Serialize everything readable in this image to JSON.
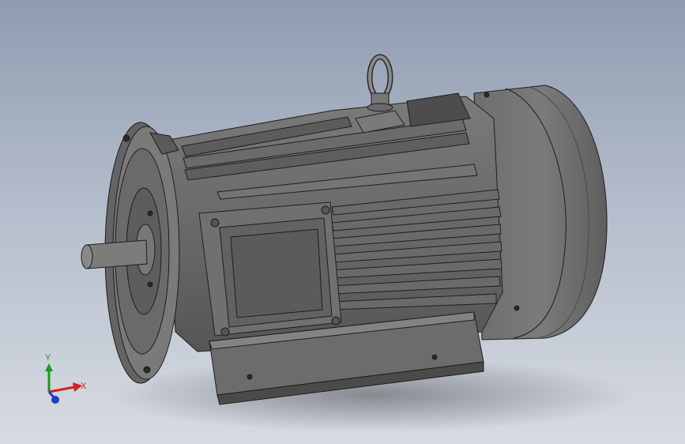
{
  "viewport": {
    "background_top": "#8f9cb0",
    "background_bottom": "#d7dbe2"
  },
  "model": {
    "body_color": "#6e6e6e",
    "dark_color": "#3a3a3a",
    "edge_color": "#1e1e1e",
    "light_color": "#8a8a8a"
  },
  "triad": {
    "x_label": "X",
    "y_label": "Y",
    "x_color": "#d22020",
    "y_color": "#1a9a1a",
    "z_color": "#1f3fc8"
  }
}
